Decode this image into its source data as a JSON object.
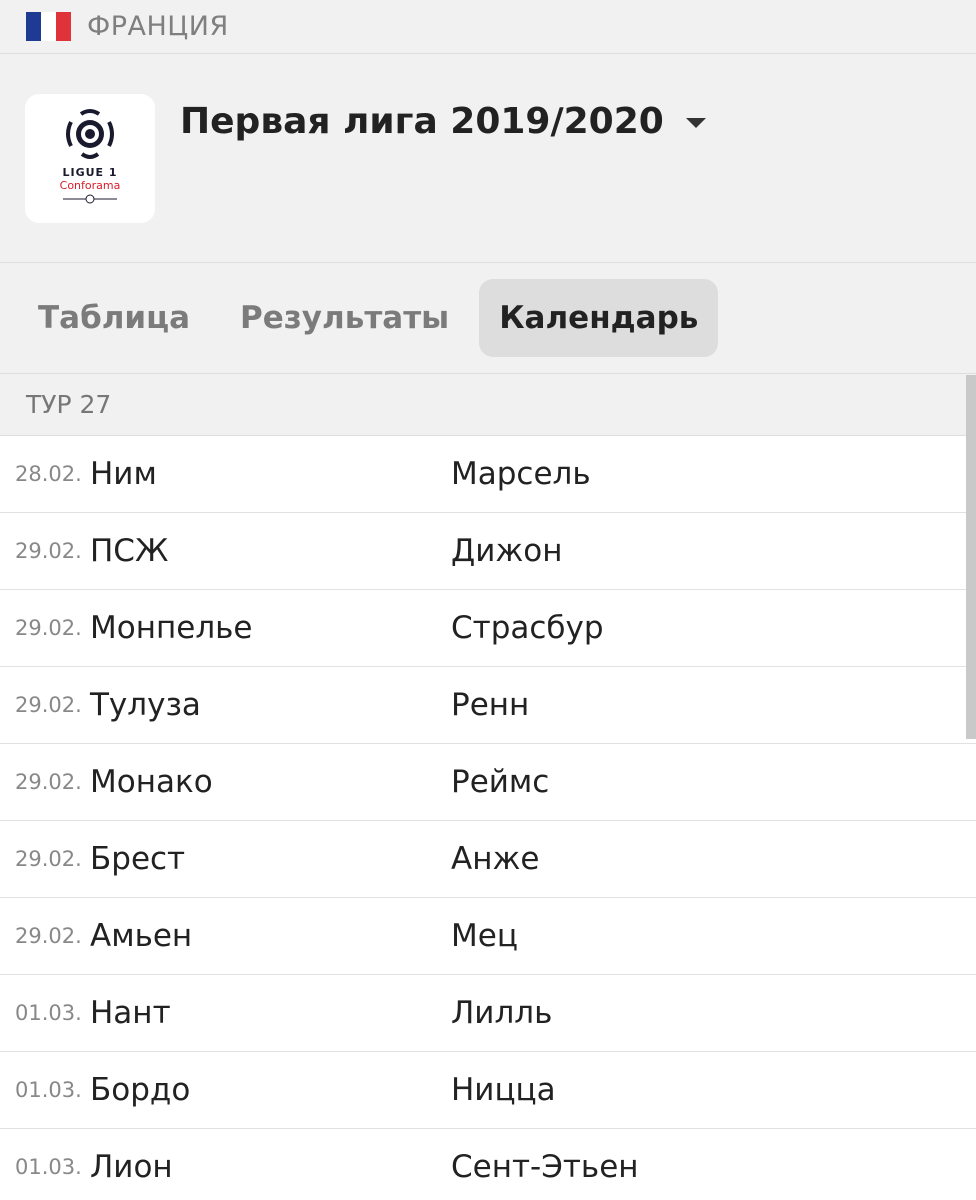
{
  "country": {
    "name": "ФРАНЦИЯ",
    "flag_colors": [
      "#1f3a93",
      "#ffffff",
      "#e0323b"
    ]
  },
  "league": {
    "title": "Первая лига 2019/2020",
    "logo_text_line1": "LIGUE 1",
    "logo_text_line2": "Conforama",
    "logo_colors": {
      "dark": "#1a1a2e",
      "red": "#d91c2a"
    }
  },
  "tabs": [
    {
      "label": "Таблица",
      "active": false
    },
    {
      "label": "Результаты",
      "active": false
    },
    {
      "label": "Календарь",
      "active": true
    }
  ],
  "round": {
    "label": "ТУР 27"
  },
  "fixtures": [
    {
      "date": "28.02.",
      "home": "Ним",
      "away": "Марсель"
    },
    {
      "date": "29.02.",
      "home": "ПСЖ",
      "away": "Дижон"
    },
    {
      "date": "29.02.",
      "home": "Монпелье",
      "away": "Страсбур"
    },
    {
      "date": "29.02.",
      "home": "Тулуза",
      "away": "Ренн"
    },
    {
      "date": "29.02.",
      "home": "Монако",
      "away": "Реймс"
    },
    {
      "date": "29.02.",
      "home": "Брест",
      "away": "Анже"
    },
    {
      "date": "29.02.",
      "home": "Амьен",
      "away": "Мец"
    },
    {
      "date": "01.03.",
      "home": "Нант",
      "away": "Лилль"
    },
    {
      "date": "01.03.",
      "home": "Бордо",
      "away": "Ницца"
    },
    {
      "date": "01.03.",
      "home": "Лион",
      "away": "Сент-Этьен"
    }
  ]
}
